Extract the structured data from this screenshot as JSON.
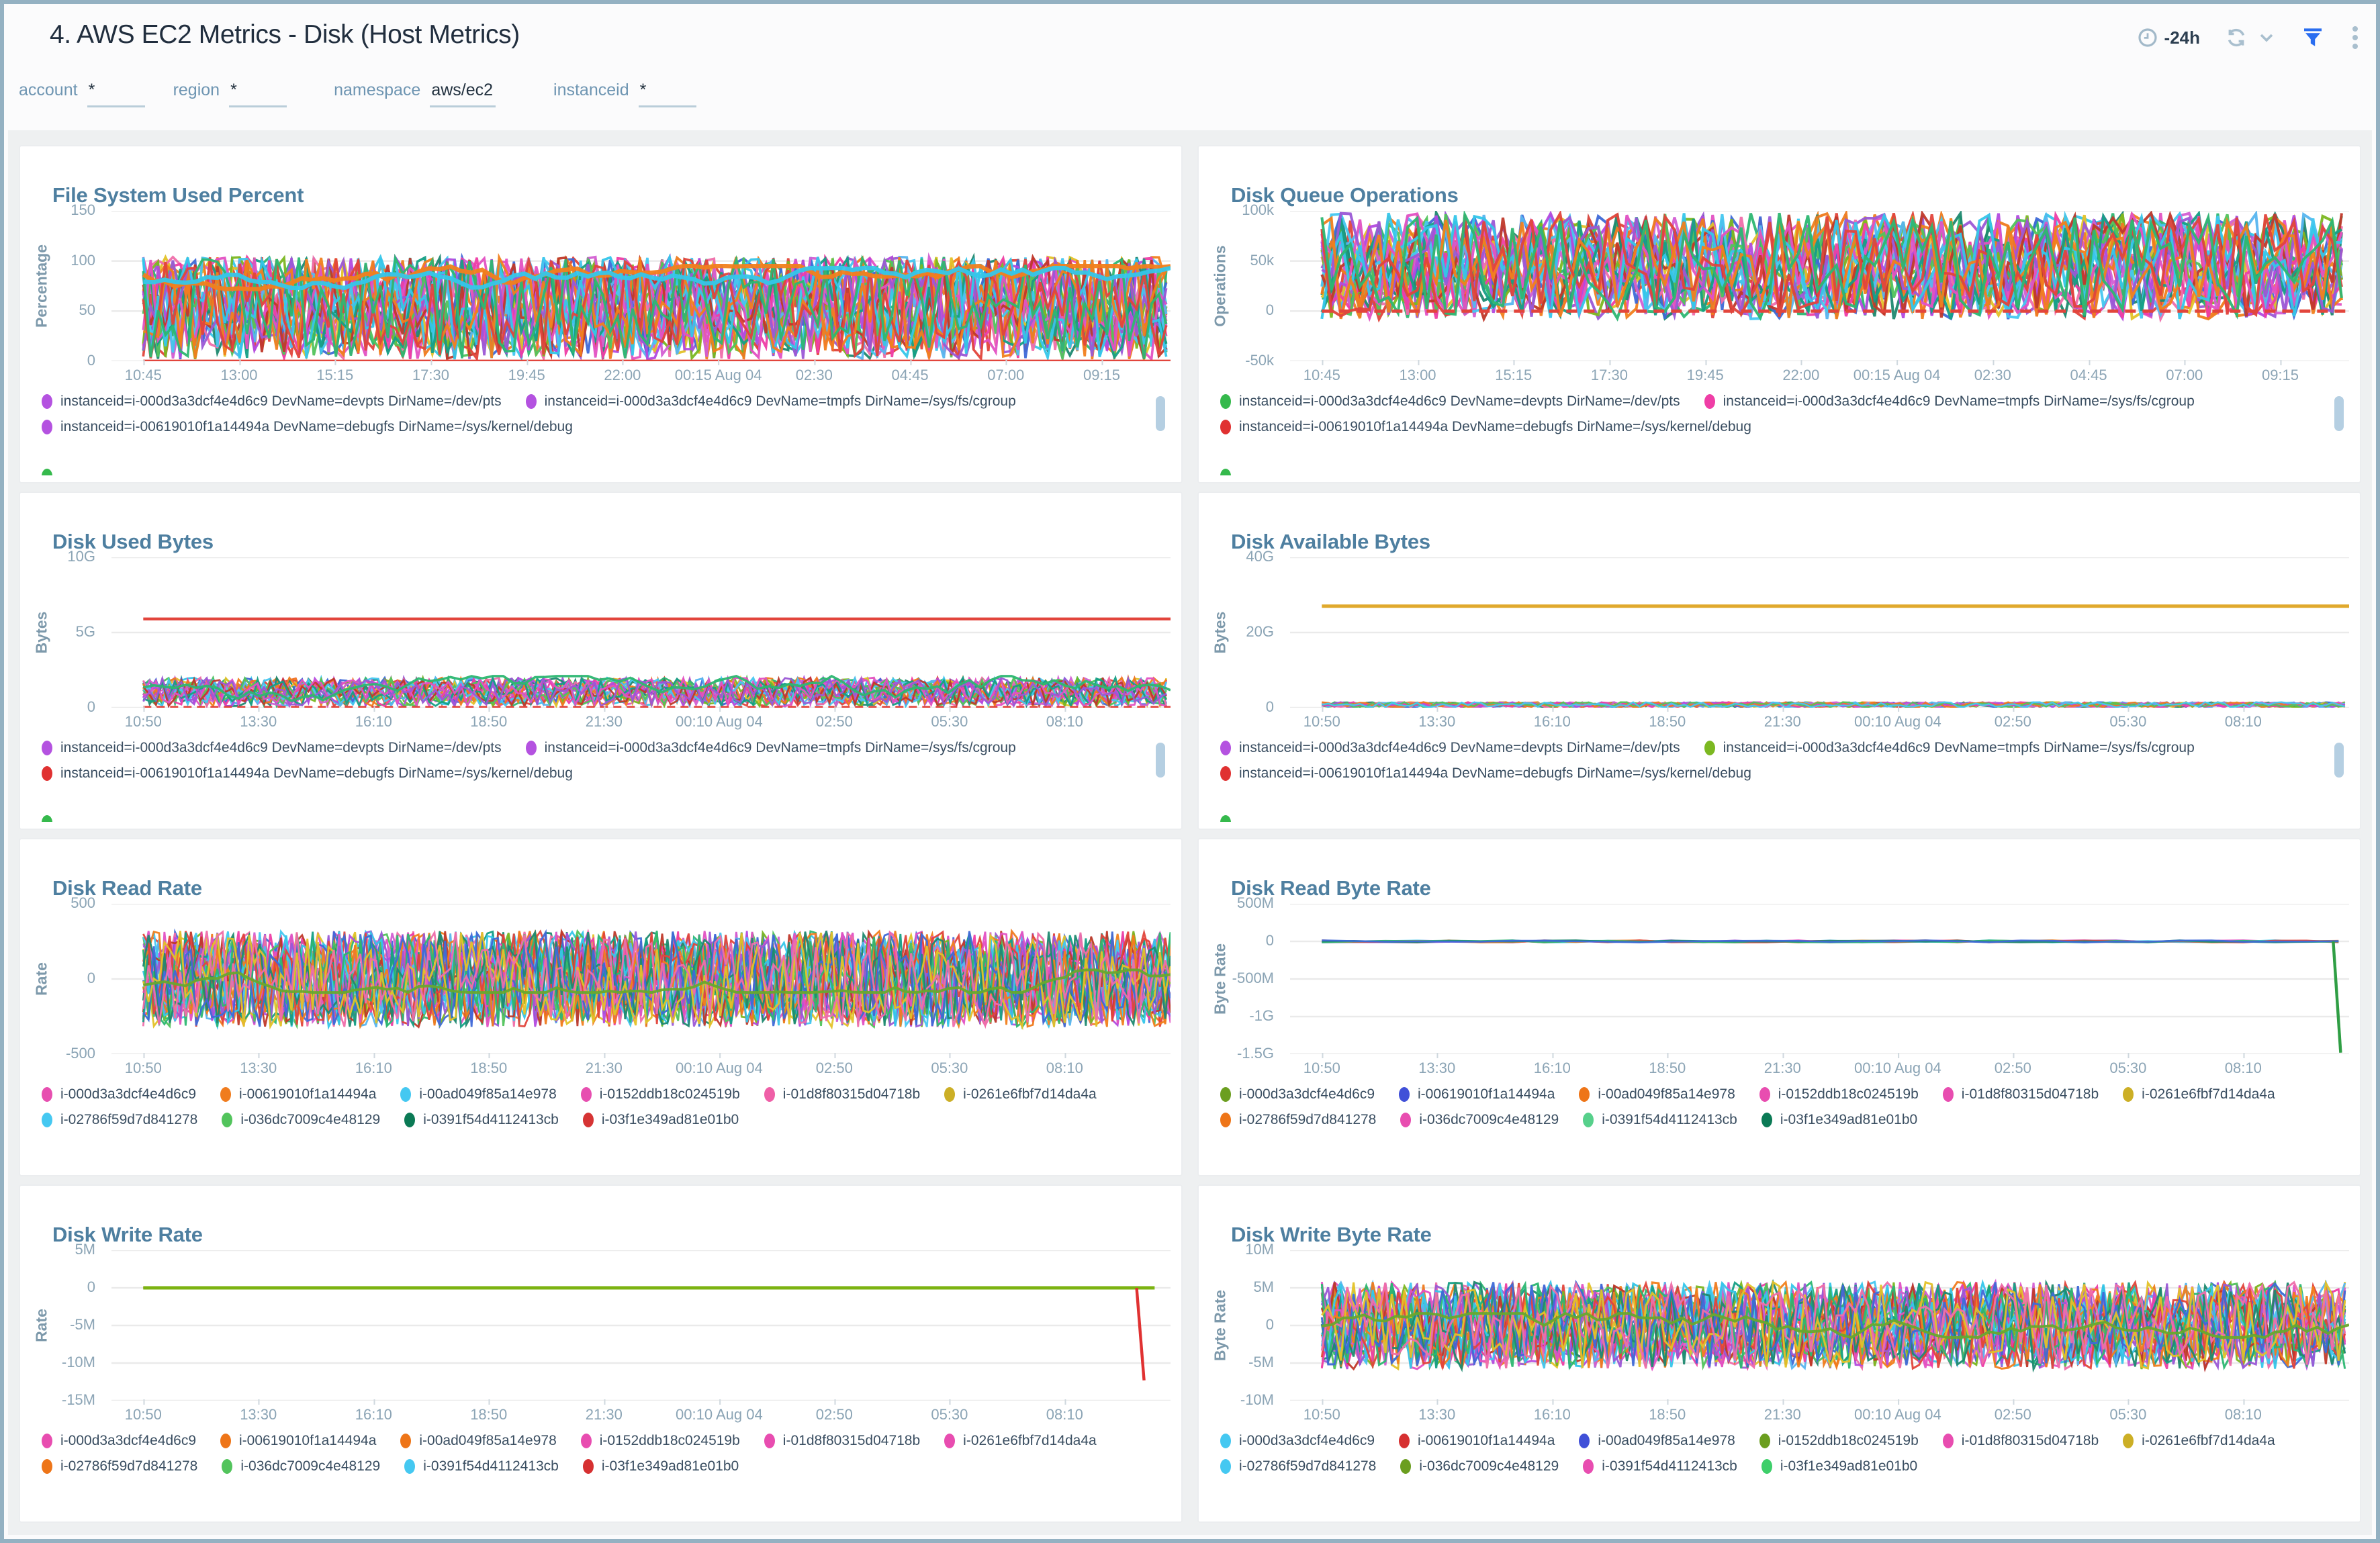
{
  "header": {
    "title": "4. AWS EC2 Metrics - Disk (Host Metrics)",
    "time_range": "-24h",
    "accent_blue": "#2a6df0",
    "icon_gray": "#a2b9c9"
  },
  "filters": [
    {
      "label": "account",
      "value": "*"
    },
    {
      "label": "region",
      "value": "*"
    },
    {
      "label": "namespace",
      "value": "aws/ec2"
    },
    {
      "label": "instanceid",
      "value": "*"
    }
  ],
  "palette": [
    "#e352c3",
    "#9b59d6",
    "#35c7ea",
    "#f2801d",
    "#e2453c",
    "#2eb872",
    "#1f8a70",
    "#3f6ad8",
    "#e3c229",
    "#f06eaa",
    "#7cb821",
    "#d35fd3",
    "#58b6f0",
    "#b44ae0",
    "#ef3ea6",
    "#f07c1e",
    "#52c45c",
    "#45c8f1",
    "#c0392b",
    "#16a085"
  ],
  "x_ticks_top": [
    "10:45",
    "13:00",
    "15:15",
    "17:30",
    "19:45",
    "22:00",
    "00:15 Aug 04",
    "02:30",
    "04:45",
    "07:00",
    "09:15"
  ],
  "x_ticks_lower": [
    "10:50",
    "13:30",
    "16:10",
    "18:50",
    "21:30",
    "00:10 Aug 04",
    "02:50",
    "05:30",
    "08:10"
  ],
  "chart_data": [
    {
      "type": "line",
      "title": "File System Used Percent",
      "ylabel": "Percentage",
      "y_ticks": [
        "150",
        "100",
        "50",
        "0"
      ],
      "y_range": [
        0,
        150
      ],
      "grid": "horizontal",
      "legend_position": "bottom",
      "x_ticks": [
        "10:45",
        "13:00",
        "15:15",
        "17:30",
        "19:45",
        "22:00",
        "00:15 Aug 04",
        "02:30",
        "04:45",
        "07:00",
        "09:15"
      ],
      "series_summary": {
        "description": "~26 overlapping per-device series oscillating between 0 and 100 percent with spikes to ~104",
        "band": [
          2,
          100
        ],
        "count": 26,
        "overshoot": 4,
        "step": 7,
        "width": 1.8
      },
      "walks": [
        {
          "color": "#f2801d",
          "range": [
            72,
            95
          ],
          "width": 3.2
        },
        {
          "color": "#35c7ea",
          "range": [
            73,
            93
          ],
          "width": 3.2
        }
      ],
      "flat_lines": [
        {
          "value": 0,
          "color": "#e2453c",
          "width": 2.4
        }
      ],
      "legend": [
        {
          "label": "instanceid=i-000d3a3dcf4e4d6c9 DevName=devpts DirName=/dev/pts",
          "color": "#b452e0"
        },
        {
          "label": "instanceid=i-000d3a3dcf4e4d6c9 DevName=tmpfs DirName=/sys/fs/cgroup",
          "color": "#b452e0"
        },
        {
          "label": "instanceid=i-00619010f1a14494a DevName=debugfs DirName=/sys/kernel/debug",
          "color": "#b452e0"
        }
      ],
      "legend_overflow_dot": "#35b94c",
      "legend_scrollbar": true
    },
    {
      "type": "line",
      "title": "Disk Queue Operations",
      "ylabel": "Operations",
      "y_ticks": [
        "100k",
        "50k",
        "0",
        "-50k"
      ],
      "y_range": [
        -50000,
        100000
      ],
      "grid": "horizontal",
      "legend_position": "bottom",
      "x_ticks": [
        "10:45",
        "13:00",
        "15:15",
        "17:30",
        "19:45",
        "22:00",
        "00:15 Aug 04",
        "02:30",
        "04:45",
        "07:00",
        "09:15"
      ],
      "series_summary": {
        "description": "~26 overlapping series oscillating 0 to 100k operations with dips to -8k",
        "band": [
          -8000,
          98000
        ],
        "count": 26,
        "overshoot": 0,
        "step": 9,
        "width": 2
      },
      "flat_lines": [
        {
          "value": 0,
          "color": "#e2453c",
          "width": 2.4,
          "dash": "8 5"
        }
      ],
      "legend": [
        {
          "label": "instanceid=i-000d3a3dcf4e4d6c9 DevName=devpts DirName=/dev/pts",
          "color": "#35b94c"
        },
        {
          "label": "instanceid=i-000d3a3dcf4e4d6c9 DevName=tmpfs DirName=/sys/fs/cgroup",
          "color": "#ef3ea6"
        },
        {
          "label": "instanceid=i-00619010f1a14494a DevName=debugfs DirName=/sys/kernel/debug",
          "color": "#e03131"
        }
      ],
      "legend_overflow_dot": "#35b94c",
      "legend_scrollbar": true
    },
    {
      "type": "line",
      "title": "Disk Used Bytes",
      "ylabel": "Bytes",
      "y_ticks": [
        "10G",
        "5G",
        "0"
      ],
      "y_range": [
        0,
        10000000000
      ],
      "grid": "horizontal",
      "legend_position": "bottom",
      "x_ticks": [
        "10:50",
        "13:30",
        "16:10",
        "18:50",
        "21:30",
        "00:10 Aug 04",
        "02:50",
        "05:30",
        "08:10"
      ],
      "series_summary": {
        "description": "most series oscillate 0-2G; one flat series at ~5.9G",
        "band": [
          100000000,
          2000000000
        ],
        "count": 22,
        "overshoot": 0,
        "step": 6,
        "width": 1.4
      },
      "walks": [
        {
          "color": "#2eb872",
          "range": [
            200000000,
            2100000000
          ],
          "width": 1.8
        }
      ],
      "flat_lines": [
        {
          "value": 5900000000,
          "color": "#e2453c",
          "width": 2.2
        },
        {
          "value": 50000000,
          "color": "#e2453c",
          "width": 1.5,
          "dash": "6 4"
        }
      ],
      "legend": [
        {
          "label": "instanceid=i-000d3a3dcf4e4d6c9 DevName=devpts DirName=/dev/pts",
          "color": "#b452e0"
        },
        {
          "label": "instanceid=i-000d3a3dcf4e4d6c9 DevName=tmpfs DirName=/sys/fs/cgroup",
          "color": "#b452e0"
        },
        {
          "label": "instanceid=i-00619010f1a14494a DevName=debugfs DirName=/sys/kernel/debug",
          "color": "#e03131"
        }
      ],
      "legend_overflow_dot": "#35b94c",
      "legend_scrollbar": true
    },
    {
      "type": "line",
      "title": "Disk Available Bytes",
      "ylabel": "Bytes",
      "y_ticks": [
        "40G",
        "20G",
        "0"
      ],
      "y_range": [
        0,
        40000000000
      ],
      "grid": "horizontal",
      "legend_position": "bottom",
      "x_ticks": [
        "10:50",
        "13:30",
        "16:10",
        "18:50",
        "21:30",
        "00:10 Aug 04",
        "02:50",
        "05:30",
        "08:10"
      ],
      "series_summary": {
        "description": "most series hug 0-1.5G; one flat series at ~27G",
        "band": [
          100000000,
          1500000000
        ],
        "count": 18,
        "overshoot": 0,
        "step": 6,
        "width": 1.2
      },
      "flat_lines": [
        {
          "value": 27000000000,
          "color": "#e0a92c",
          "width": 2.5
        }
      ],
      "legend": [
        {
          "label": "instanceid=i-000d3a3dcf4e4d6c9 DevName=devpts DirName=/dev/pts",
          "color": "#b452e0"
        },
        {
          "label": "instanceid=i-000d3a3dcf4e4d6c9 DevName=tmpfs DirName=/sys/fs/cgroup",
          "color": "#7cb821"
        },
        {
          "label": "instanceid=i-00619010f1a14494a DevName=debugfs DirName=/sys/kernel/debug",
          "color": "#e03131"
        }
      ],
      "legend_overflow_dot": "#35b94c",
      "legend_scrollbar": true
    },
    {
      "type": "line",
      "title": "Disk Read Rate",
      "ylabel": "Rate",
      "y_ticks": [
        "500",
        "0",
        "-500"
      ],
      "y_range": [
        -500,
        500
      ],
      "grid": "horizontal",
      "legend_position": "bottom",
      "x_ticks": [
        "10:50",
        "13:30",
        "16:10",
        "18:50",
        "21:30",
        "00:10 Aug 04",
        "02:50",
        "05:30",
        "08:10"
      ],
      "series_summary": {
        "description": "10 instance series oscillating roughly -320 to +320 ops/s",
        "band": [
          -320,
          320
        ],
        "count": 30,
        "overshoot": 0,
        "step": 5,
        "width": 1.4
      },
      "walks": [
        {
          "color": "#69a82f",
          "range": [
            -90,
            60
          ],
          "width": 2
        }
      ],
      "legend": [
        {
          "label": "i-000d3a3dcf4e4d6c9",
          "color": "#e74fb0"
        },
        {
          "label": "i-00619010f1a14494a",
          "color": "#f07c1e"
        },
        {
          "label": "i-00ad049f85a14e978",
          "color": "#45c8f1"
        },
        {
          "label": "i-0152ddb18c024519b",
          "color": "#e74fb0"
        },
        {
          "label": "i-01d8f80315d04718b",
          "color": "#ef5fa7"
        },
        {
          "label": "i-0261e6fbf7d14da4a",
          "color": "#ccaf26"
        },
        {
          "label": "i-02786f59d7d841278",
          "color": "#45c8f1"
        },
        {
          "label": "i-036dc7009c4e48129",
          "color": "#52c45c"
        },
        {
          "label": "i-0391f54d4112413cb",
          "color": "#0b7a55"
        },
        {
          "label": "i-03f1e349ad81e01b0",
          "color": "#d63434"
        }
      ]
    },
    {
      "type": "line",
      "title": "Disk Read Byte Rate",
      "ylabel": "Byte Rate",
      "y_ticks": [
        "500M",
        "0",
        "-500M",
        "-1G",
        "-1.5G"
      ],
      "y_range": [
        -1500000000,
        500000000
      ],
      "grid": "horizontal",
      "legend_position": "bottom",
      "x_ticks": [
        "10:50",
        "13:30",
        "16:10",
        "18:50",
        "21:30",
        "00:10 Aug 04",
        "02:50",
        "05:30",
        "08:10"
      ],
      "series_summary": {
        "description": "all series flat near 0 B/s; one green series drops to about -1.5G at the right edge",
        "band": [
          -15000000,
          15000000
        ],
        "count": 8,
        "overshoot": 0,
        "step": 30,
        "width": 1.3
      },
      "drops": [
        {
          "x": 0.985,
          "from": 0,
          "to": -1480000000,
          "color": "#2f9e44"
        }
      ],
      "legend": [
        {
          "label": "i-000d3a3dcf4e4d6c9",
          "color": "#6b9e1f"
        },
        {
          "label": "i-00619010f1a14494a",
          "color": "#4050d8"
        },
        {
          "label": "i-00ad049f85a14e978",
          "color": "#ee7518"
        },
        {
          "label": "i-0152ddb18c024519b",
          "color": "#e84db0"
        },
        {
          "label": "i-01d8f80315d04718b",
          "color": "#e84db0"
        },
        {
          "label": "i-0261e6fbf7d14da4a",
          "color": "#ccaf26"
        },
        {
          "label": "i-02786f59d7d841278",
          "color": "#ee7518"
        },
        {
          "label": "i-036dc7009c4e48129",
          "color": "#e84db0"
        },
        {
          "label": "i-0391f54d4112413cb",
          "color": "#57d08b"
        },
        {
          "label": "i-03f1e349ad81e01b0",
          "color": "#0b7a55"
        }
      ]
    },
    {
      "type": "line",
      "title": "Disk Write Rate",
      "ylabel": "Rate",
      "y_ticks": [
        "5M",
        "0",
        "-5M",
        "-10M",
        "-15M"
      ],
      "y_range": [
        -15000000,
        5000000
      ],
      "grid": "horizontal",
      "legend_position": "bottom",
      "x_ticks": [
        "10:50",
        "13:30",
        "16:10",
        "18:50",
        "21:30",
        "00:10 Aug 04",
        "02:50",
        "05:30",
        "08:10"
      ],
      "series_summary": {
        "description": "green series flat at 0; red series drops to about -12M near the right edge"
      },
      "flat_lines": [
        {
          "value": 0,
          "color": "#e03131",
          "width": 1.5,
          "x1": 0.968
        },
        {
          "value": 0,
          "color": "#7cb312",
          "width": 2.5,
          "x1": 0.985
        }
      ],
      "drops": [
        {
          "x": 0.968,
          "from": 0,
          "to": -12300000,
          "color": "#e03131"
        }
      ],
      "legend": [
        {
          "label": "i-000d3a3dcf4e4d6c9",
          "color": "#e84db0"
        },
        {
          "label": "i-00619010f1a14494a",
          "color": "#ee7518"
        },
        {
          "label": "i-00ad049f85a14e978",
          "color": "#ee7518"
        },
        {
          "label": "i-0152ddb18c024519b",
          "color": "#e84db0"
        },
        {
          "label": "i-01d8f80315d04718b",
          "color": "#e84db0"
        },
        {
          "label": "i-0261e6fbf7d14da4a",
          "color": "#e84db0"
        },
        {
          "label": "i-02786f59d7d841278",
          "color": "#ee7518"
        },
        {
          "label": "i-036dc7009c4e48129",
          "color": "#52c45c"
        },
        {
          "label": "i-0391f54d4112413cb",
          "color": "#45c8f1"
        },
        {
          "label": "i-03f1e349ad81e01b0",
          "color": "#d63031"
        }
      ]
    },
    {
      "type": "line",
      "title": "Disk Write Byte Rate",
      "ylabel": "Byte Rate",
      "y_ticks": [
        "10M",
        "5M",
        "0",
        "-5M",
        "-10M"
      ],
      "y_range": [
        -10000000,
        10000000
      ],
      "grid": "horizontal",
      "legend_position": "bottom",
      "x_ticks": [
        "10:50",
        "13:30",
        "16:10",
        "18:50",
        "21:30",
        "00:10 Aug 04",
        "02:50",
        "05:30",
        "08:10"
      ],
      "series_summary": {
        "description": "10 instance series oscillating roughly -6M to +6M B/s",
        "band": [
          -5800000,
          5800000
        ],
        "count": 30,
        "overshoot": 0,
        "step": 6,
        "width": 1.5
      },
      "walks": [
        {
          "color": "#69a82f",
          "range": [
            -1600000,
            1600000
          ],
          "width": 2
        }
      ],
      "legend": [
        {
          "label": "i-000d3a3dcf4e4d6c9",
          "color": "#45c8f1"
        },
        {
          "label": "i-00619010f1a14494a",
          "color": "#d63031"
        },
        {
          "label": "i-00ad049f85a14e978",
          "color": "#4050d8"
        },
        {
          "label": "i-0152ddb18c024519b",
          "color": "#6b9e1f"
        },
        {
          "label": "i-01d8f80315d04718b",
          "color": "#e84db0"
        },
        {
          "label": "i-0261e6fbf7d14da4a",
          "color": "#ccaf26"
        },
        {
          "label": "i-02786f59d7d841278",
          "color": "#45c8f1"
        },
        {
          "label": "i-036dc7009c4e48129",
          "color": "#6b9e1f"
        },
        {
          "label": "i-0391f54d4112413cb",
          "color": "#e84db0"
        },
        {
          "label": "i-03f1e349ad81e01b0",
          "color": "#3ecf6a"
        }
      ]
    }
  ]
}
